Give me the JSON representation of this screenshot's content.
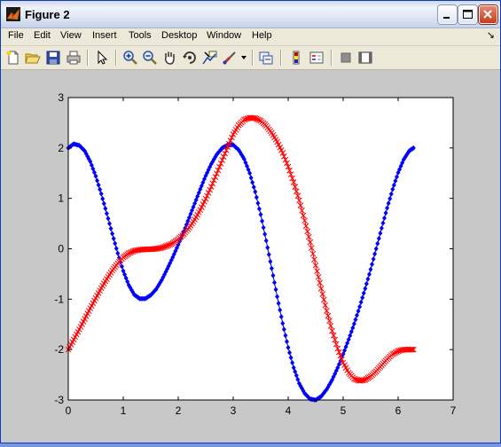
{
  "window": {
    "title": "Figure 2"
  },
  "titlebar_buttons": {
    "minimize": "minimize-button",
    "maximize": "maximize-button",
    "close": "close-button"
  },
  "menubar": {
    "items": [
      "File",
      "Edit",
      "View",
      "Insert",
      "Tools",
      "Desktop",
      "Window",
      "Help"
    ],
    "dock_glyph": "↘"
  },
  "toolbar": {
    "icons": [
      "new-figure-icon",
      "open-file-icon",
      "save-icon",
      "print-icon",
      "arrow-pointer-icon",
      "zoom-in-icon",
      "zoom-out-icon",
      "pan-hand-icon",
      "rotate-3d-icon",
      "data-cursor-icon",
      "brush-icon",
      "brush-dropdown-icon",
      "link-plot-icon",
      "colorbar-icon",
      "legend-icon",
      "hide-plot-tools-icon",
      "show-plot-tools-icon"
    ]
  },
  "colors": {
    "window_bg": "#c8c8c8",
    "plot_bg": "#ffffff",
    "series_blue": "#0000ff",
    "series_red": "#ff0000"
  },
  "chart_data": {
    "type": "line",
    "title": "",
    "xlabel": "",
    "ylabel": "",
    "xlim": [
      0,
      7
    ],
    "ylim": [
      -3,
      3
    ],
    "xticks": [
      "0",
      "1",
      "2",
      "3",
      "4",
      "5",
      "6",
      "7"
    ],
    "yticks": [
      "-3",
      "-2",
      "-1",
      "0",
      "1",
      "2",
      "3"
    ],
    "grid": false,
    "series": [
      {
        "color": "#0000ff",
        "marker": "diamond",
        "x": [
          0,
          0.1,
          0.2,
          0.3,
          0.4,
          0.5,
          0.6,
          0.7,
          0.8,
          0.9,
          1.0,
          1.1,
          1.2,
          1.3,
          1.4,
          1.5,
          1.6,
          1.7,
          1.8,
          1.9,
          2.0,
          2.1,
          2.2,
          2.3,
          2.4,
          2.5,
          2.6,
          2.7,
          2.8,
          2.9,
          3.0,
          3.1,
          3.2,
          3.3,
          3.4,
          3.5,
          3.6,
          3.7,
          3.8,
          3.9,
          4.0,
          4.1,
          4.2,
          4.3,
          4.4,
          4.5,
          4.6,
          4.7,
          4.8,
          4.9,
          5.0,
          5.1,
          5.2,
          5.3,
          5.4,
          5.5,
          5.6,
          5.7,
          5.8,
          5.9,
          6.0,
          6.1,
          6.2,
          6.28
        ],
        "y": [
          2.0,
          2.08,
          2.05,
          1.94,
          1.73,
          1.44,
          1.09,
          0.7,
          0.3,
          -0.09,
          -0.44,
          -0.72,
          -0.91,
          -0.99,
          -0.99,
          -0.92,
          -0.8,
          -0.62,
          -0.4,
          -0.17,
          0.08,
          0.34,
          0.62,
          0.9,
          1.18,
          1.45,
          1.68,
          1.87,
          2.0,
          2.06,
          2.06,
          1.96,
          1.78,
          1.5,
          1.13,
          0.68,
          0.16,
          -0.39,
          -0.95,
          -1.48,
          -1.96,
          -2.36,
          -2.67,
          -2.87,
          -2.98,
          -3.0,
          -2.93,
          -2.79,
          -2.6,
          -2.36,
          -2.09,
          -1.8,
          -1.49,
          -1.15,
          -0.79,
          -0.41,
          0.0,
          0.41,
          0.81,
          1.18,
          1.51,
          1.77,
          1.94,
          2.0
        ]
      },
      {
        "color": "#ff0000",
        "marker": "cross",
        "x": [
          0,
          0.1,
          0.2,
          0.3,
          0.4,
          0.5,
          0.6,
          0.7,
          0.8,
          0.9,
          1.0,
          1.1,
          1.2,
          1.3,
          1.4,
          1.5,
          1.6,
          1.7,
          1.8,
          1.9,
          2.0,
          2.1,
          2.2,
          2.3,
          2.4,
          2.5,
          2.6,
          2.7,
          2.8,
          2.9,
          3.0,
          3.1,
          3.2,
          3.3,
          3.4,
          3.5,
          3.6,
          3.7,
          3.8,
          3.9,
          4.0,
          4.1,
          4.2,
          4.3,
          4.4,
          4.5,
          4.6,
          4.7,
          4.8,
          4.9,
          5.0,
          5.1,
          5.2,
          5.3,
          5.4,
          5.5,
          5.6,
          5.7,
          5.8,
          5.9,
          6.0,
          6.1,
          6.2,
          6.28
        ],
        "y": [
          -2.0,
          -1.8,
          -1.6,
          -1.39,
          -1.18,
          -0.98,
          -0.78,
          -0.6,
          -0.43,
          -0.29,
          -0.17,
          -0.09,
          -0.04,
          -0.02,
          -0.01,
          -0.01,
          0.0,
          0.02,
          0.06,
          0.11,
          0.19,
          0.29,
          0.42,
          0.58,
          0.77,
          0.99,
          1.23,
          1.49,
          1.76,
          2.02,
          2.27,
          2.45,
          2.56,
          2.6,
          2.59,
          2.54,
          2.44,
          2.3,
          2.12,
          1.9,
          1.63,
          1.32,
          0.96,
          0.56,
          0.13,
          -0.33,
          -0.79,
          -1.23,
          -1.63,
          -1.98,
          -2.26,
          -2.46,
          -2.58,
          -2.62,
          -2.6,
          -2.53,
          -2.43,
          -2.31,
          -2.19,
          -2.09,
          -2.03,
          -2.0,
          -2.0,
          -2.0
        ]
      }
    ]
  }
}
